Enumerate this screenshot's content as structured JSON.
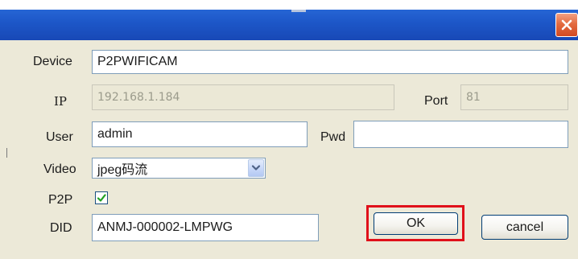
{
  "dialog": {
    "close_icon": "close-icon"
  },
  "device": {
    "label": "Device",
    "value": "P2PWIFICAM"
  },
  "ip": {
    "label": "IP",
    "value": "192.168.1.184"
  },
  "port": {
    "label": "Port",
    "value": "81"
  },
  "user": {
    "label": "User",
    "value": "admin"
  },
  "pwd": {
    "label": "Pwd",
    "value": ""
  },
  "video": {
    "label": "Video",
    "selected": "jpeg码流",
    "arrow_icon": "chevron-down-icon"
  },
  "p2p": {
    "label": "P2P",
    "checked": true
  },
  "did": {
    "label": "DID",
    "value": "ANMJ-000002-LMPWG"
  },
  "buttons": {
    "ok": "OK",
    "cancel": "cancel"
  },
  "colors": {
    "titlebar": "#1d57c8",
    "close": "#d24a22",
    "highlight": "#e0101a",
    "window_bg": "#ece9d8"
  }
}
